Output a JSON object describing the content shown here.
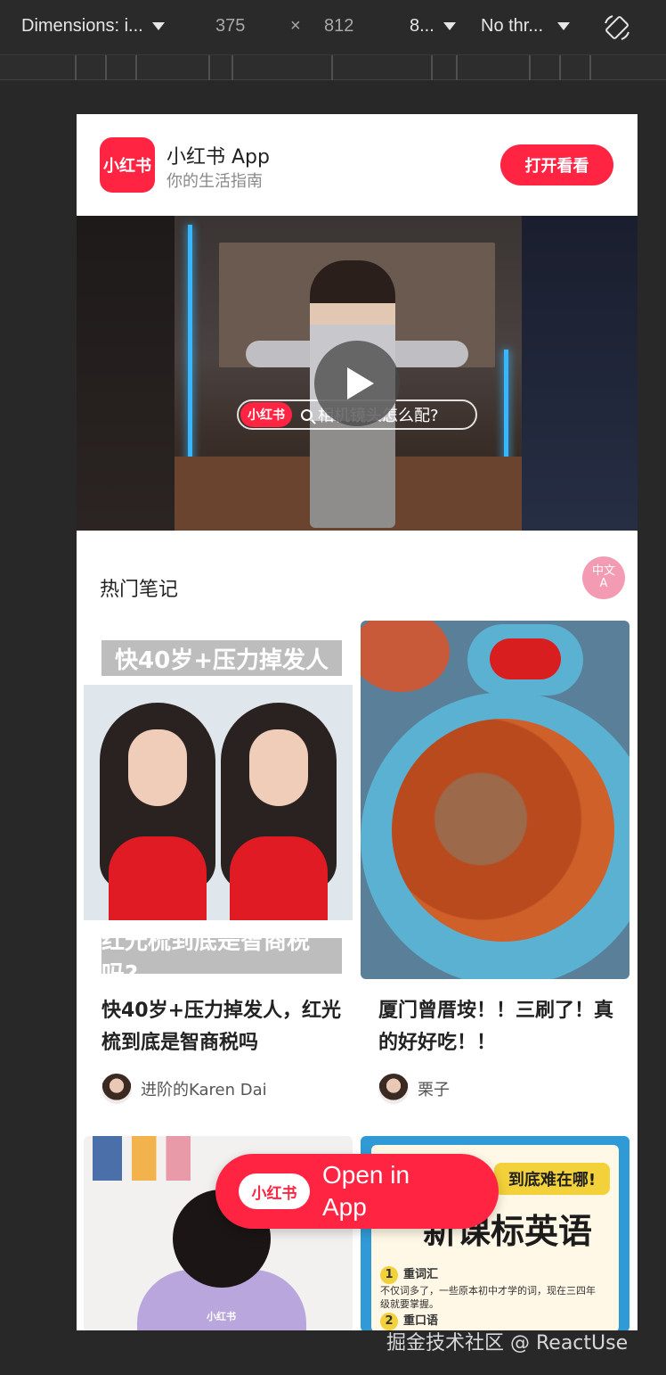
{
  "devtools": {
    "dimensions_label": "Dimensions: i...",
    "width": "375",
    "times": "×",
    "height": "812",
    "zoom": "8...",
    "throttle": "No thr..."
  },
  "header": {
    "logo_text": "小红书",
    "app_name": "小红书 App",
    "tagline": "你的生活指南",
    "open_button": "打开看看"
  },
  "video": {
    "logo_text": "小红书",
    "search_text": "相机镜头怎么配?"
  },
  "section": {
    "title": "热门笔记",
    "translate_top": "中文",
    "translate_bottom": "A"
  },
  "cards": [
    {
      "banner_top": "快40岁+压力掉发人",
      "banner_bottom": "红光梳到底是智商税吗?",
      "title": "快40岁+压力掉发人，红光梳到底是智商税吗",
      "author": "进阶的Karen Dai"
    },
    {
      "title": "厦门曾厝垵！！三刷了！真的好好吃！！",
      "author": "栗子"
    },
    {
      "watermark": "小红书"
    },
    {
      "tag": "到底难在哪!",
      "headline": "新课标英语",
      "row1_num": "1",
      "row1_title": "重词汇",
      "row1_text": "不仅词多了，一些原本初中才学的词，现在三四年级就要掌握。",
      "row2_num": "2",
      "row2_title": "重口语"
    }
  ],
  "floating": {
    "logo_text": "小红书",
    "label": "Open in App"
  },
  "watermark": "掘金技术社区 @ ReactUse"
}
